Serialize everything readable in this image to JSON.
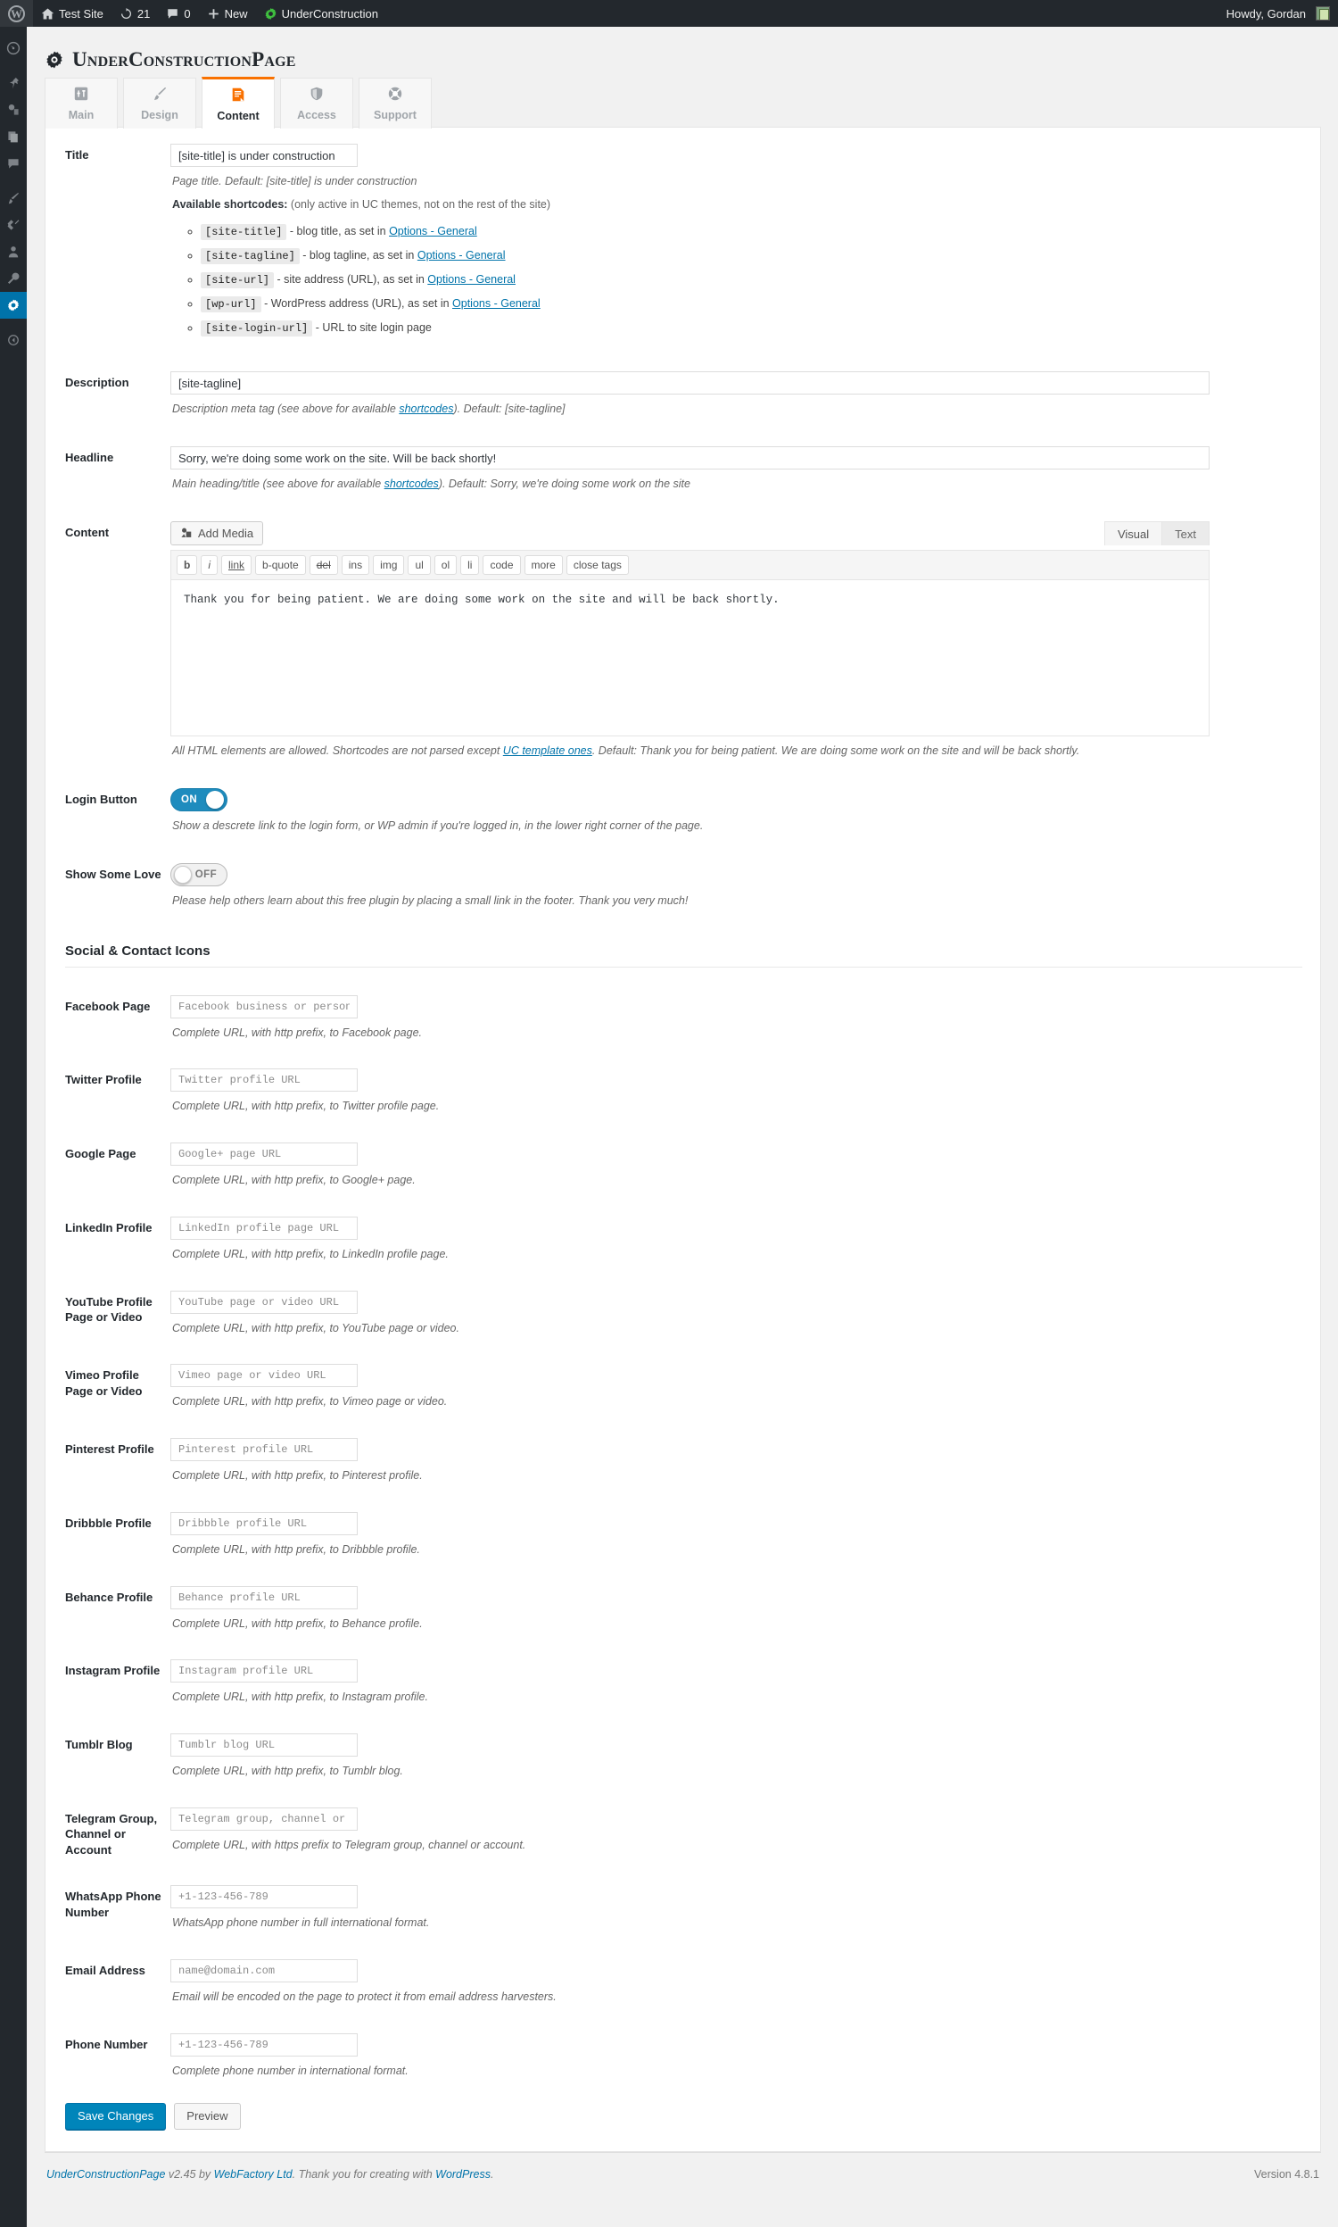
{
  "adminbar": {
    "site_name": "Test Site",
    "updates_count": "21",
    "comments_count": "0",
    "new_label": "New",
    "plugin_label": "UnderConstruction",
    "howdy": "Howdy, Gordan"
  },
  "sidebar": {
    "items": [
      {
        "name": "dashboard",
        "icon": "dashboard-icon"
      },
      {
        "name": "posts",
        "icon": "pin-icon"
      },
      {
        "name": "media",
        "icon": "media-icon"
      },
      {
        "name": "pages",
        "icon": "pages-icon"
      },
      {
        "name": "comments",
        "icon": "comment-icon"
      },
      {
        "name": "appearance",
        "icon": "brush-icon"
      },
      {
        "name": "plugins",
        "icon": "plug-icon"
      },
      {
        "name": "users",
        "icon": "user-icon"
      },
      {
        "name": "tools",
        "icon": "tools-icon"
      },
      {
        "name": "settings",
        "icon": "settings-icon"
      },
      {
        "name": "collapse",
        "icon": "collapse-icon"
      }
    ]
  },
  "header": {
    "title": "UnderConstructionPage",
    "icon": "gear-icon"
  },
  "tabs": [
    {
      "label": "Main",
      "icon": "sliders-icon",
      "active": false
    },
    {
      "label": "Design",
      "icon": "brush-icon",
      "active": false
    },
    {
      "label": "Content",
      "icon": "document-icon",
      "active": true
    },
    {
      "label": "Access",
      "icon": "shield-icon",
      "active": false
    },
    {
      "label": "Support",
      "icon": "lifebuoy-icon",
      "active": false
    }
  ],
  "form": {
    "title": {
      "label": "Title",
      "value": "[site-title] is under construction",
      "desc": "Page title. Default: [site-title] is under construction",
      "shortcodes_label": "Available shortcodes:",
      "shortcodes_note": "(only active in UC themes, not on the rest of the site)",
      "shortcodes": [
        {
          "code": "[site-title]",
          "text": " - blog title, as set in ",
          "link": "Options - General"
        },
        {
          "code": "[site-tagline]",
          "text": " - blog tagline, as set in ",
          "link": "Options - General"
        },
        {
          "code": "[site-url]",
          "text": " - site address (URL), as set in ",
          "link": "Options - General"
        },
        {
          "code": "[wp-url]",
          "text": " - WordPress address (URL), as set in ",
          "link": "Options - General"
        },
        {
          "code": "[site-login-url]",
          "text": " - URL to site login page",
          "link": ""
        }
      ]
    },
    "description": {
      "label": "Description",
      "value": "[site-tagline]",
      "desc_a": "Description meta tag (see above for available ",
      "desc_link": "shortcodes",
      "desc_b": "). Default: [site-tagline]"
    },
    "headline": {
      "label": "Headline",
      "value": "Sorry, we're doing some work on the site. Will be back shortly!",
      "desc_a": "Main heading/title (see above for available ",
      "desc_link": "shortcodes",
      "desc_b": "). Default: Sorry, we're doing some work on the site"
    },
    "content": {
      "label": "Content",
      "add_media": "Add Media",
      "visual_tab": "Visual",
      "text_tab": "Text",
      "quicktags": [
        "b",
        "i",
        "link",
        "b-quote",
        "del",
        "ins",
        "img",
        "ul",
        "ol",
        "li",
        "code",
        "more",
        "close tags"
      ],
      "body": "Thank you for being patient. We are doing some work on the site and will be back shortly.",
      "desc_a": "All HTML elements are allowed. Shortcodes are not parsed except ",
      "desc_link": "UC template ones",
      "desc_b": ". Default: Thank you for being patient. We are doing some work on the site and will be back shortly."
    },
    "login_button": {
      "label": "Login Button",
      "state": "ON",
      "desc": "Show a descrete link to the login form, or WP admin if you're logged in, in the lower right corner of the page."
    },
    "show_some_love": {
      "label": "Show Some Love",
      "state": "OFF",
      "desc": "Please help others learn about this free plugin by placing a small link in the footer. Thank you very much!"
    }
  },
  "social_section": {
    "heading": "Social & Contact Icons",
    "fields": [
      {
        "label": "Facebook Page",
        "placeholder": "Facebook business or personal page URL",
        "desc": "Complete URL, with http prefix, to Facebook page.",
        "wide": false
      },
      {
        "label": "Twitter Profile",
        "placeholder": "Twitter profile URL",
        "desc": "Complete URL, with http prefix, to Twitter profile page.",
        "wide": false
      },
      {
        "label": "Google Page",
        "placeholder": "Google+ page URL",
        "desc": "Complete URL, with http prefix, to Google+ page.",
        "wide": false
      },
      {
        "label": "LinkedIn Profile",
        "placeholder": "LinkedIn profile page URL",
        "desc": "Complete URL, with http prefix, to LinkedIn profile page.",
        "wide": false
      },
      {
        "label": "YouTube Profile Page or Video",
        "placeholder": "YouTube page or video URL",
        "desc": "Complete URL, with http prefix, to YouTube page or video.",
        "wide": false
      },
      {
        "label": "Vimeo Profile Page or Video",
        "placeholder": "Vimeo page or video URL",
        "desc": "Complete URL, with http prefix, to Vimeo page or video.",
        "wide": false
      },
      {
        "label": "Pinterest Profile",
        "placeholder": "Pinterest profile URL",
        "desc": "Complete URL, with http prefix, to Pinterest profile.",
        "wide": false
      },
      {
        "label": "Dribbble Profile",
        "placeholder": "Dribbble profile URL",
        "desc": "Complete URL, with http prefix, to Dribbble profile.",
        "wide": false
      },
      {
        "label": "Behance Profile",
        "placeholder": "Behance profile URL",
        "desc": "Complete URL, with http prefix, to Behance profile.",
        "wide": false
      },
      {
        "label": "Instagram Profile",
        "placeholder": "Instagram profile URL",
        "desc": "Complete URL, with http prefix, to Instagram profile.",
        "wide": false
      },
      {
        "label": "Tumblr Blog",
        "placeholder": "Tumblr blog URL",
        "desc": "Complete URL, with http prefix, to Tumblr blog.",
        "wide": false
      },
      {
        "label": "Telegram Group, Channel or Account",
        "placeholder": "Telegram group, channel or account URL",
        "desc": "Complete URL, with https prefix to Telegram group, channel or account.",
        "wide": true
      },
      {
        "label": "WhatsApp Phone Number",
        "placeholder": "+1-123-456-789",
        "desc": "WhatsApp phone number in full international format.",
        "wide": false
      },
      {
        "label": "Email Address",
        "placeholder": "name@domain.com",
        "desc": "Email will be encoded on the page to protect it from email address harvesters.",
        "wide": false
      },
      {
        "label": "Phone Number",
        "placeholder": "+1-123-456-789",
        "desc": "Complete phone number in international format.",
        "wide": false
      }
    ]
  },
  "actions": {
    "save": "Save Changes",
    "preview": "Preview"
  },
  "footer": {
    "plugin_link": "UnderConstructionPage",
    "version_text": " v2.45 by ",
    "vendor_link": "WebFactory Ltd",
    "thanks_a": ". Thank you for creating with ",
    "wp_link": "WordPress",
    "thanks_b": ".",
    "wp_version": "Version 4.8.1"
  },
  "colors": {
    "accent_orange": "#f97100",
    "wp_blue": "#0085ba",
    "toggle_on": "#1e8cbe",
    "adminbar_bg": "#23282d"
  }
}
